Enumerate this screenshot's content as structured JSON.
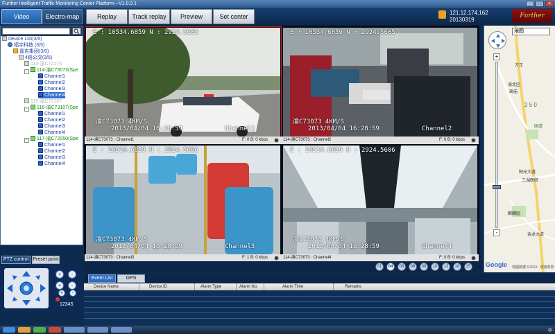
{
  "window": {
    "title": "Further Intelligent Traffic Monitoring Center Platform—V1.0.0.1",
    "minimize": "_",
    "maximize": "□",
    "close": "×"
  },
  "toolbar": {
    "tabs": [
      "Video Preview",
      "Electro-map"
    ],
    "buttons": [
      "Replay",
      "Track replay",
      "Preview Image",
      "Set center"
    ],
    "server_ip": "121.12.174.162",
    "date": "20130319",
    "logo": "Further"
  },
  "tree": {
    "root": "Device List(3/5)",
    "company": "福宇科技 (3/5)",
    "group": "嘉吉集团(3/5)",
    "subgroup": "4路公交(3/5)",
    "devices": [
      {
        "name": "113-渝C72173",
        "status": "offline",
        "channels": []
      },
      {
        "name": "114-渝C73073(Spe",
        "status": "online",
        "channels": [
          "Channel1",
          "Channel2",
          "Channel3",
          "Channel4"
        ],
        "selected_channel": 3
      },
      {
        "name": "115-渝C72107",
        "status": "offline",
        "channels": []
      },
      {
        "name": "116-渝C73107(Spe",
        "status": "online",
        "channels": [
          "Channel1",
          "Channel2",
          "Channel3",
          "Channel4"
        ]
      },
      {
        "name": "117-渝C72050(Spe",
        "status": "online",
        "channels": [
          "Channel1",
          "Channel2",
          "Channel3",
          "Channel4"
        ]
      }
    ]
  },
  "ptz": {
    "tabs": [
      "PTZ control",
      "Preset point"
    ],
    "speed_levels": "12345",
    "zoom_buttons": [
      "+",
      "-",
      "+",
      "-",
      "+",
      "-"
    ]
  },
  "videos": [
    {
      "osd_top": "E : 10534.6859   N : 2924.5605",
      "plate": "渝C73073   4KM/S",
      "time": "2013/04/04 16:28:59",
      "ch": "Channel1",
      "label": "114-渝C73073 : Channel1",
      "stats": "F: 0     B: 0 kbps"
    },
    {
      "osd_top": "E : 10534.6859   N : 2924.5605",
      "plate": "渝C73073   4KM/S",
      "time": "2013/04/04 16:28:59",
      "ch": "Channel2",
      "label": "114-渝C73073 : Channel2",
      "stats": "F: 0     B: 0 kbps"
    },
    {
      "osd_top": "E : 10534.6859   N : 2924.5606",
      "plate": "渝C73073   4KM/S",
      "time": "2013/04/04 16:28:59",
      "ch": "Channel3",
      "label": "114-渝C73073 : Channel3",
      "stats": "F: 1     B: 0 kbps"
    },
    {
      "osd_top": "E : 10534.6859   N : 2924.5606",
      "plate": "渝C73073   4KM/S",
      "time": "2013/04/04 16:28:59",
      "ch": "Channel4",
      "label": "114-渝C73073 : Channel4",
      "stats": "F: 0     B: 0 kbps"
    }
  ],
  "pagebar": {
    "buttons": [
      "01",
      "04",
      "06",
      "08",
      "09",
      "10",
      "13",
      "16",
      "25"
    ],
    "active_index": 1
  },
  "map": {
    "type_select": "地图",
    "zoom_in": "+",
    "zoom_out": "-",
    "labels": [
      "方正",
      "渝北区",
      "高庙",
      "2 5 0",
      "国道",
      "阳光大道",
      "三湖医院",
      "麒麟园",
      "金龙大道"
    ],
    "google": "Google",
    "copyright": "地图数据 ©2013 - 使用条款"
  },
  "events": {
    "tabs": [
      "Event List",
      "GPS monitoring"
    ],
    "columns": [
      "Device Name",
      "Device ID",
      "Alarm Type",
      "Alarm No.",
      "Alarm Time",
      "Remarks"
    ]
  },
  "taskbar": {
    "tray": "中"
  }
}
